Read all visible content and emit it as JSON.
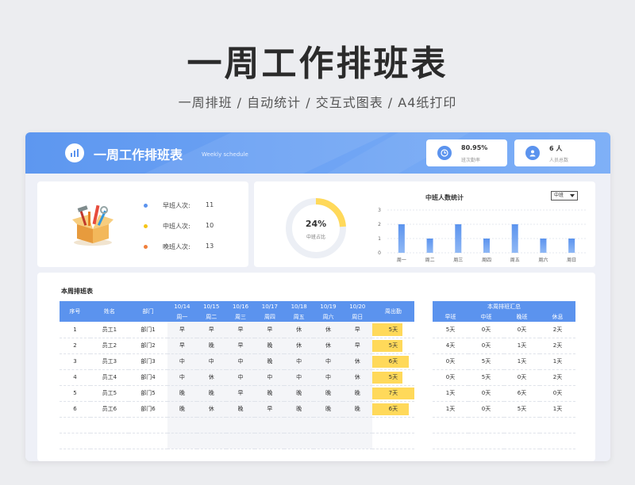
{
  "hero": {
    "title": "一周工作排班表",
    "subtitle": "一周排班 / 自动统计 / 交互式图表 / A4纸打印"
  },
  "header": {
    "title": "一周工作排班表",
    "subtitle": "Weekly schedule",
    "logo_icon": "bar-chart-icon",
    "cards": [
      {
        "value": "80.95%",
        "label": "班次勤率",
        "icon": "clock-icon"
      },
      {
        "value": "6 人",
        "label": "人员总数",
        "icon": "user-icon"
      }
    ]
  },
  "summary": {
    "image_icon": "toolbox-illustration-icon",
    "legend": [
      {
        "label": "早班人次:",
        "value": "11",
        "color": "#5b93ee"
      },
      {
        "label": "中班人次:",
        "value": "10",
        "color": "#f5c518"
      },
      {
        "label": "晚班人次:",
        "value": "13",
        "color": "#f07f3c"
      }
    ]
  },
  "donut": {
    "percent_label": "24%",
    "percent_value": 24,
    "label": "中班占比",
    "color": "#ffd95a",
    "track_color": "#eceff5"
  },
  "chart_data": {
    "type": "bar",
    "title": "中班人数统计",
    "categories": [
      "周一",
      "周二",
      "周三",
      "周四",
      "周五",
      "周六",
      "周日"
    ],
    "values": [
      2,
      1,
      2,
      1,
      2,
      1,
      1
    ],
    "ylim": [
      0,
      3
    ],
    "yticks": [
      "0",
      "1",
      "2",
      "3"
    ],
    "grid": true,
    "color": "#5b93ee",
    "select_value": "中班"
  },
  "schedule": {
    "title": "本周排班表",
    "date_headers": [
      "10/14",
      "10/15",
      "10/16",
      "10/17",
      "10/18",
      "10/19",
      "10/20"
    ],
    "day_headers": [
      "周一",
      "周二",
      "周三",
      "周四",
      "周五",
      "周六",
      "周日"
    ],
    "col_seq": "序号",
    "col_name": "姓名",
    "col_dept": "部门",
    "col_attendance": "周出勤",
    "rows": [
      {
        "seq": "1",
        "name": "员工1",
        "dept": "部门1",
        "shifts": [
          "早",
          "早",
          "早",
          "早",
          "休",
          "休",
          "早"
        ],
        "attendance": "5天",
        "fill": 0.71
      },
      {
        "seq": "2",
        "name": "员工2",
        "dept": "部门2",
        "shifts": [
          "早",
          "晚",
          "早",
          "晚",
          "休",
          "休",
          "早"
        ],
        "attendance": "5天",
        "fill": 0.71
      },
      {
        "seq": "3",
        "name": "员工3",
        "dept": "部门3",
        "shifts": [
          "中",
          "中",
          "中",
          "晚",
          "中",
          "中",
          "休"
        ],
        "attendance": "6天",
        "fill": 0.86
      },
      {
        "seq": "4",
        "name": "员工4",
        "dept": "部门4",
        "shifts": [
          "中",
          "休",
          "中",
          "中",
          "中",
          "中",
          "休"
        ],
        "attendance": "5天",
        "fill": 0.71
      },
      {
        "seq": "5",
        "name": "员工5",
        "dept": "部门5",
        "shifts": [
          "晚",
          "晚",
          "早",
          "晚",
          "晚",
          "晚",
          "晚"
        ],
        "attendance": "7天",
        "fill": 1.0
      },
      {
        "seq": "6",
        "name": "员工6",
        "dept": "部门6",
        "shifts": [
          "晚",
          "休",
          "晚",
          "早",
          "晚",
          "晚",
          "晚"
        ],
        "attendance": "6天",
        "fill": 0.86
      }
    ]
  },
  "totals": {
    "title": "本周排班汇总",
    "headers": [
      "早班",
      "中班",
      "晚班",
      "休息"
    ],
    "rows": [
      [
        "5天",
        "0天",
        "0天",
        "2天"
      ],
      [
        "4天",
        "0天",
        "1天",
        "2天"
      ],
      [
        "0天",
        "5天",
        "1天",
        "1天"
      ],
      [
        "0天",
        "5天",
        "0天",
        "2天"
      ],
      [
        "1天",
        "0天",
        "6天",
        "0天"
      ],
      [
        "1天",
        "0天",
        "5天",
        "1天"
      ]
    ]
  }
}
